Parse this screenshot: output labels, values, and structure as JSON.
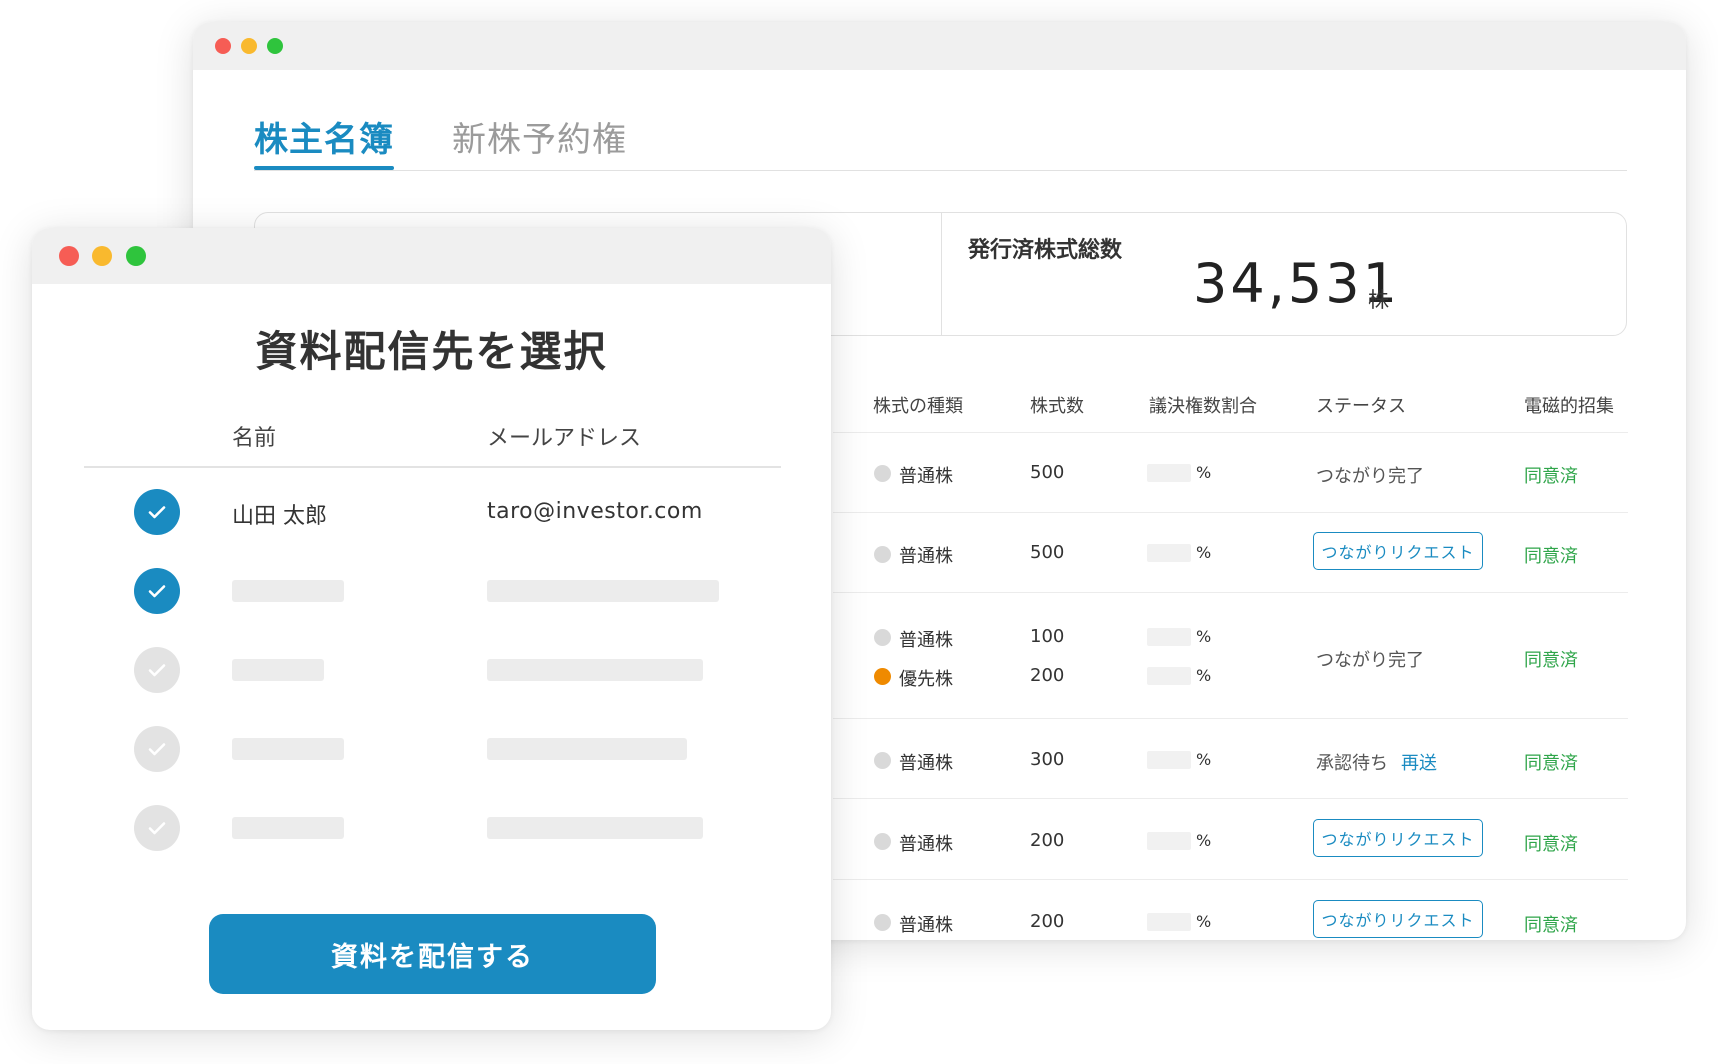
{
  "back_window": {
    "tabs": [
      {
        "label": "株主名簿",
        "active": true
      },
      {
        "label": "新株予約権",
        "active": false
      }
    ],
    "summary": {
      "label": "発行済株式総数",
      "value": "34,531",
      "unit": "株"
    },
    "table": {
      "headers": [
        "株式の種類",
        "株式数",
        "議決権数割合",
        "ステータス",
        "電磁的招集"
      ],
      "rows": [
        {
          "types": [
            {
              "type": "普通株",
              "shares": "500",
              "pct": "%",
              "color": "#d9d9d9"
            }
          ],
          "status": "つながり完了",
          "status_kind": "text",
          "consent": "同意済"
        },
        {
          "types": [
            {
              "type": "普通株",
              "shares": "500",
              "pct": "%",
              "color": "#d9d9d9"
            }
          ],
          "status": "つながりリクエスト",
          "status_kind": "button",
          "consent": "同意済"
        },
        {
          "types": [
            {
              "type": "普通株",
              "shares": "100",
              "pct": "%",
              "color": "#d9d9d9"
            },
            {
              "type": "優先株",
              "shares": "200",
              "pct": "%",
              "color": "#ef8a00"
            }
          ],
          "status": "つながり完了",
          "status_kind": "text",
          "consent": "同意済"
        },
        {
          "types": [
            {
              "type": "普通株",
              "shares": "300",
              "pct": "%",
              "color": "#d9d9d9"
            }
          ],
          "status": "承認待ち",
          "status_link": "再送",
          "status_kind": "text",
          "consent": "同意済"
        },
        {
          "types": [
            {
              "type": "普通株",
              "shares": "200",
              "pct": "%",
              "color": "#d9d9d9"
            }
          ],
          "status": "つながりリクエスト",
          "status_kind": "button",
          "consent": "同意済"
        },
        {
          "types": [
            {
              "type": "普通株",
              "shares": "200",
              "pct": "%",
              "color": "#d9d9d9"
            }
          ],
          "status": "つながりリクエスト",
          "status_kind": "button",
          "consent": "同意済"
        }
      ]
    }
  },
  "front_window": {
    "title": "資料配信先を選択",
    "headers": {
      "name": "名前",
      "email": "メールアドレス"
    },
    "recipients": [
      {
        "name": "山田 太郎",
        "email": "taro@investor.com",
        "checked": true
      },
      {
        "name": "",
        "email": "",
        "checked": true
      },
      {
        "name": "",
        "email": "",
        "checked": false
      },
      {
        "name": "",
        "email": "",
        "checked": false
      },
      {
        "name": "",
        "email": "",
        "checked": false
      }
    ],
    "send_button": "資料を配信する"
  },
  "colors": {
    "accent": "#1a8bc1",
    "consent_green": "#2fa54a",
    "preferred_orange": "#ef8a00"
  }
}
